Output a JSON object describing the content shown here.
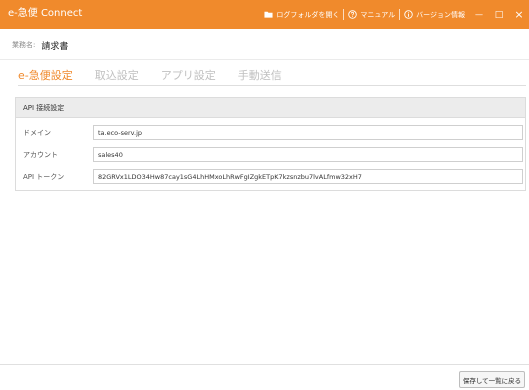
{
  "titlebar": {
    "app_title": "e-急便 Connect",
    "open_log_folder": "ログフォルダを開く",
    "manual": "マニュアル",
    "version_info": "バージョン情報",
    "minimize_glyph": "—",
    "maximize_glyph": "□",
    "close_glyph": "×"
  },
  "business": {
    "label": "業務名:",
    "value": "請求書"
  },
  "tabs": [
    {
      "label": "e-急便設定",
      "active": true
    },
    {
      "label": "取込設定",
      "active": false
    },
    {
      "label": "アプリ設定",
      "active": false
    },
    {
      "label": "手動送信",
      "active": false
    }
  ],
  "api_panel": {
    "header": "API 接続設定",
    "fields": [
      {
        "label": "ドメイン",
        "value": "ta.eco-serv.jp"
      },
      {
        "label": "アカウント",
        "value": "sales40"
      },
      {
        "label": "API トークン",
        "value": "82GRVx1LDO34Hw87cay1sG4LhHMxoLhRwFgIZgkETpK7kzsnzbu7lvALfmw32xH7"
      }
    ]
  },
  "footer": {
    "save_back_label": "保存して一覧に戻る"
  },
  "colors": {
    "accent": "#f08a2c",
    "panel_header_bg": "#ececec",
    "inactive_tab": "#c0c0c0"
  },
  "icons": {
    "folder": "folder-icon",
    "manual": "question-circle-icon",
    "version": "info-circle-icon"
  }
}
